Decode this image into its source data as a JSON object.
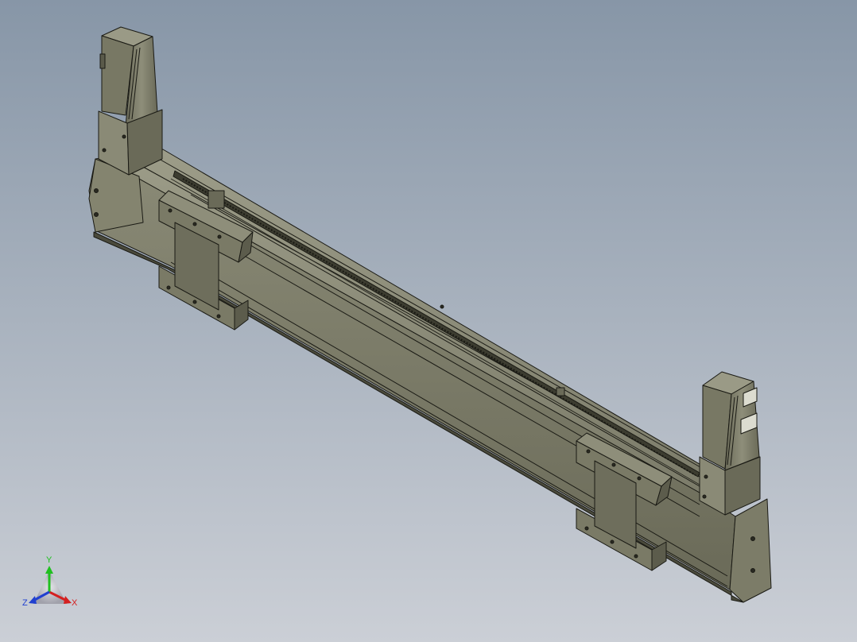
{
  "viewport": {
    "background_top": "#8a98a8",
    "background_bottom": "#c9cdd4",
    "model_color": "#7a7a68",
    "model_dark": "#5a5a4a",
    "model_light": "#9a9a86",
    "edge_color": "#1a1a14"
  },
  "triad": {
    "x_label": "X",
    "y_label": "Y",
    "z_label": "Z",
    "x_color": "#d42020",
    "y_color": "#20c020",
    "z_color": "#2040d0"
  }
}
